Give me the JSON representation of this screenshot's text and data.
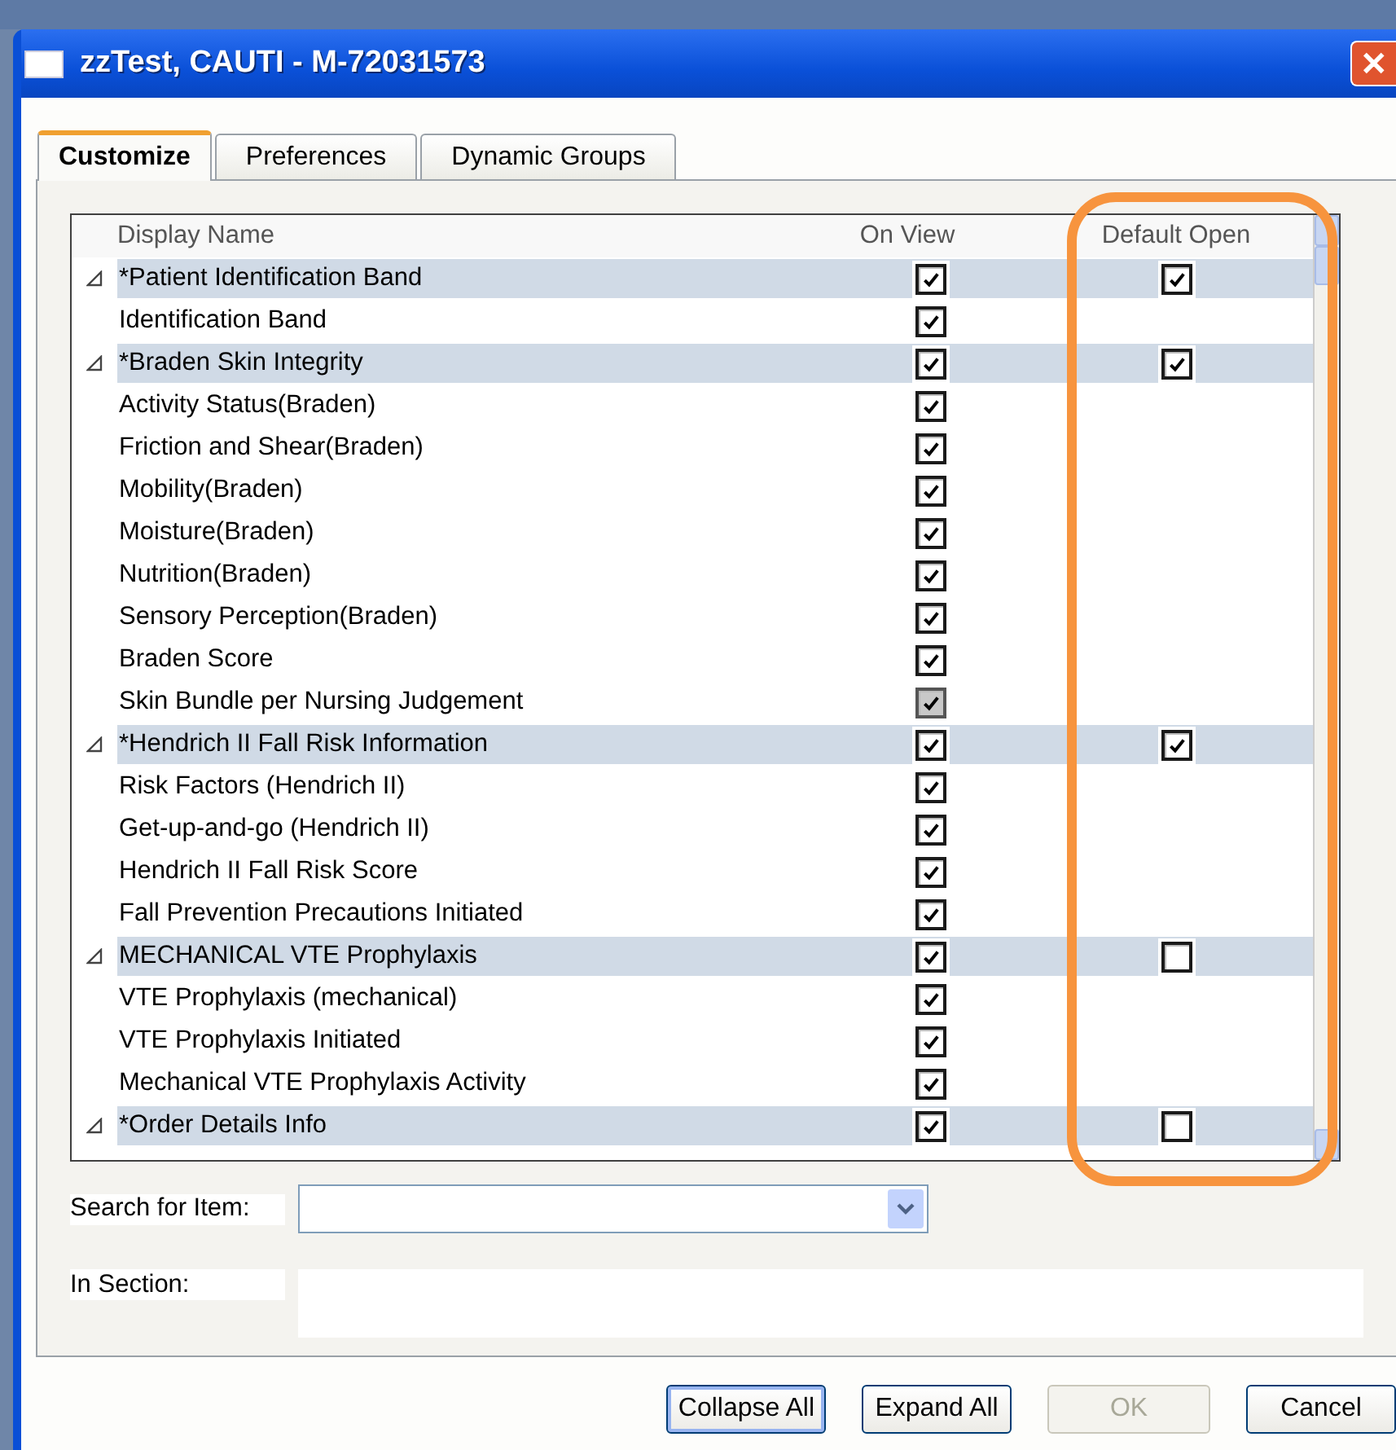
{
  "window": {
    "title": "zzTest, CAUTI - M-72031573",
    "close_label": "✕"
  },
  "tabs": [
    {
      "label": "Customize",
      "selected": true
    },
    {
      "label": "Preferences",
      "selected": false
    },
    {
      "label": "Dynamic Groups",
      "selected": false
    }
  ],
  "tree": {
    "columns": [
      "Display Name",
      "On View",
      "Default Open"
    ],
    "rows": [
      {
        "kind": "section",
        "name": "*Patient Identification Band",
        "on_view": true,
        "on_view_disabled": false,
        "default_open": true,
        "expanded": true
      },
      {
        "kind": "item",
        "name": "Identification Band",
        "on_view": true,
        "on_view_disabled": false
      },
      {
        "kind": "section",
        "name": "*Braden Skin Integrity",
        "on_view": true,
        "on_view_disabled": false,
        "default_open": true,
        "expanded": true
      },
      {
        "kind": "item",
        "name": "Activity Status(Braden)",
        "on_view": true,
        "on_view_disabled": false
      },
      {
        "kind": "item",
        "name": "Friction and Shear(Braden)",
        "on_view": true,
        "on_view_disabled": false
      },
      {
        "kind": "item",
        "name": "Mobility(Braden)",
        "on_view": true,
        "on_view_disabled": false
      },
      {
        "kind": "item",
        "name": "Moisture(Braden)",
        "on_view": true,
        "on_view_disabled": false
      },
      {
        "kind": "item",
        "name": "Nutrition(Braden)",
        "on_view": true,
        "on_view_disabled": false
      },
      {
        "kind": "item",
        "name": "Sensory Perception(Braden)",
        "on_view": true,
        "on_view_disabled": false
      },
      {
        "kind": "item",
        "name": "Braden Score",
        "on_view": true,
        "on_view_disabled": false
      },
      {
        "kind": "item",
        "name": "Skin Bundle per Nursing Judgement",
        "on_view": true,
        "on_view_disabled": true
      },
      {
        "kind": "section",
        "name": "*Hendrich II Fall Risk Information",
        "on_view": true,
        "on_view_disabled": false,
        "default_open": true,
        "expanded": true
      },
      {
        "kind": "item",
        "name": "Risk Factors (Hendrich II)",
        "on_view": true,
        "on_view_disabled": false
      },
      {
        "kind": "item",
        "name": "Get-up-and-go (Hendrich II)",
        "on_view": true,
        "on_view_disabled": false
      },
      {
        "kind": "item",
        "name": "Hendrich II Fall Risk Score",
        "on_view": true,
        "on_view_disabled": false
      },
      {
        "kind": "item",
        "name": "Fall Prevention Precautions Initiated",
        "on_view": true,
        "on_view_disabled": false
      },
      {
        "kind": "section",
        "name": "MECHANICAL VTE Prophylaxis",
        "on_view": true,
        "on_view_disabled": false,
        "default_open": false,
        "expanded": true
      },
      {
        "kind": "item",
        "name": "VTE Prophylaxis (mechanical)",
        "on_view": true,
        "on_view_disabled": false
      },
      {
        "kind": "item",
        "name": "VTE Prophylaxis Initiated",
        "on_view": true,
        "on_view_disabled": false
      },
      {
        "kind": "item",
        "name": "Mechanical VTE Prophylaxis Activity",
        "on_view": true,
        "on_view_disabled": false
      },
      {
        "kind": "section",
        "name": "*Order Details Info",
        "on_view": true,
        "on_view_disabled": false,
        "default_open": false,
        "expanded": true
      }
    ]
  },
  "search": {
    "label": "Search for Item:"
  },
  "in_section": {
    "label": "In Section:"
  },
  "buttons": [
    {
      "label": "Collapse All",
      "disabled": false,
      "focused": true
    },
    {
      "label": "Expand All",
      "disabled": false,
      "focused": false
    },
    {
      "label": "OK",
      "disabled": true,
      "focused": false
    },
    {
      "label": "Cancel",
      "disabled": false,
      "focused": false
    }
  ],
  "annotation": {
    "kind": "outline"
  }
}
